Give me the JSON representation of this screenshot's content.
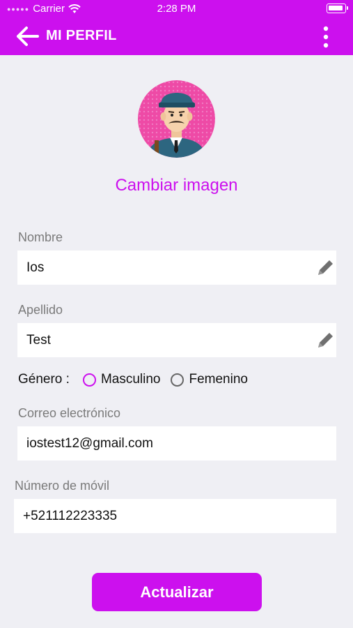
{
  "status_bar": {
    "carrier": "Carrier",
    "time": "2:28 PM",
    "icons": [
      "wifi-icon",
      "battery-icon"
    ]
  },
  "header": {
    "title": "MI PERFIL",
    "back_icon": "arrow-left-icon",
    "menu_icon": "more-vertical-icon"
  },
  "profile": {
    "change_image_label": "Cambiar imagen",
    "avatar": "avatar-icon"
  },
  "form": {
    "first_name": {
      "label": "Nombre",
      "value": "Ios",
      "icon": "pencil-icon"
    },
    "last_name": {
      "label": "Apellido",
      "value": "Test",
      "icon": "pencil-icon"
    },
    "gender": {
      "label": "Género :",
      "options": [
        {
          "label": "Masculino",
          "selected": true
        },
        {
          "label": "Femenino",
          "selected": false
        }
      ]
    },
    "email": {
      "label": "Correo electrónico",
      "value": "iostest12@gmail.com"
    },
    "mobile": {
      "label": "Número de móvil",
      "value": "+521112223335"
    }
  },
  "actions": {
    "update_label": "Actualizar"
  },
  "colors": {
    "accent": "#cc10ee",
    "background": "#efeff4"
  }
}
